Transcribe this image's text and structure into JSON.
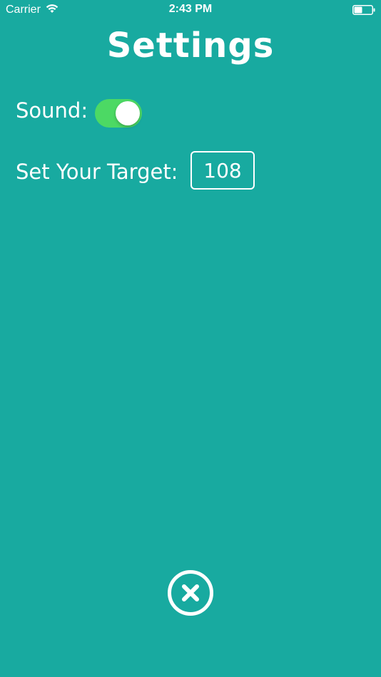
{
  "status_bar": {
    "carrier": "Carrier",
    "time": "2:43 PM",
    "wifi_icon": "wifi-icon",
    "battery_icon": "battery-icon"
  },
  "title": "Settings",
  "sound": {
    "label": "Sound:",
    "enabled": true,
    "toggle_color": "#4cd964"
  },
  "target": {
    "label": "Set Your Target:",
    "value": "108"
  },
  "close": {
    "icon": "close-icon"
  },
  "colors": {
    "background": "#18aaa0",
    "text": "#ffffff"
  }
}
